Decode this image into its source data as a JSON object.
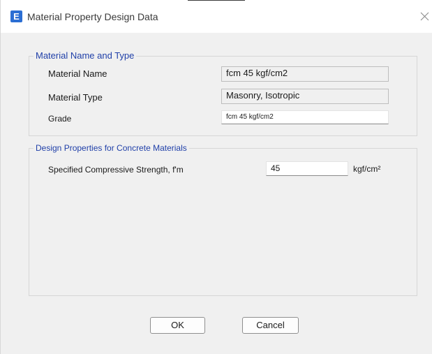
{
  "window": {
    "title": "Material Property Design Data",
    "app_icon": "E",
    "close_icon": "close-icon"
  },
  "material_group": {
    "legend": "Material Name and Type",
    "name_label": "Material Name",
    "name_value": "fcm 45 kgf/cm2",
    "type_label": "Material Type",
    "type_value": "Masonry, Isotropic",
    "grade_label": "Grade",
    "grade_value": "fcm 45 kgf/cm2"
  },
  "design_group": {
    "legend": "Design Properties for Concrete Materials",
    "strength_label": "Specified Compressive Strength, f'm",
    "strength_value": "45",
    "strength_unit": "kgf/cm²"
  },
  "buttons": {
    "ok": "OK",
    "cancel": "Cancel"
  },
  "colors": {
    "accent_icon": "#2b6ed3",
    "legend_text": "#1f3fa8"
  }
}
